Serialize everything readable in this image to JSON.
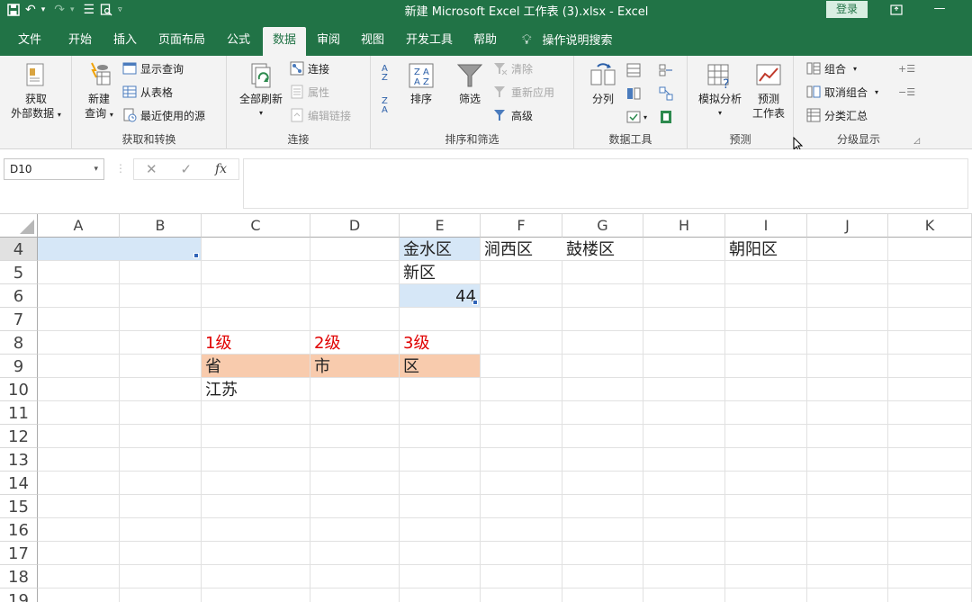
{
  "window": {
    "title": "新建 Microsoft Excel 工作表 (3).xlsx  -  Excel",
    "login": "登录"
  },
  "tabs": [
    {
      "label": "文件"
    },
    {
      "label": "开始"
    },
    {
      "label": "插入"
    },
    {
      "label": "页面布局"
    },
    {
      "label": "公式"
    },
    {
      "label": "数据",
      "active": true
    },
    {
      "label": "审阅"
    },
    {
      "label": "视图"
    },
    {
      "label": "开发工具"
    },
    {
      "label": "帮助"
    }
  ],
  "tell_me": "操作说明搜索",
  "ribbon": {
    "get_external": {
      "line1": "获取",
      "line2": "外部数据"
    },
    "get_transform": {
      "label": "获取和转换",
      "new_query_1": "新建",
      "new_query_2": "查询",
      "show_queries": "显示查询",
      "from_table": "从表格",
      "recent_sources": "最近使用的源"
    },
    "connections": {
      "label": "连接",
      "refresh_all": "全部刷新",
      "connections": "连接",
      "properties": "属性",
      "edit_links": "编辑链接"
    },
    "sort_filter": {
      "label": "排序和筛选",
      "sort": "排序",
      "filter": "筛选",
      "clear": "清除",
      "reapply": "重新应用",
      "advanced": "高级",
      "sort_az_top": "A",
      "sort_az_bottom": "Z",
      "sort_az_top2": "Z",
      "sort_az_bottom2": "A"
    },
    "data_tools": {
      "label": "数据工具",
      "text_to_columns": "分列"
    },
    "forecast": {
      "label": "预测",
      "what_if": "模拟分析",
      "forecast_sheet_1": "预测",
      "forecast_sheet_2": "工作表"
    },
    "outline": {
      "label": "分级显示",
      "group": "组合",
      "ungroup": "取消组合",
      "subtotal": "分类汇总"
    }
  },
  "formula_bar": {
    "name_box": "D10",
    "cancel": "✕",
    "enter": "✓",
    "fx": "fx",
    "content": ""
  },
  "columns": [
    "A",
    "B",
    "C",
    "D",
    "E",
    "F",
    "G",
    "H",
    "I",
    "J",
    "K"
  ],
  "rows": [
    "4",
    "5",
    "6",
    "7",
    "8",
    "9",
    "10",
    "11",
    "12",
    "13",
    "14",
    "15",
    "16",
    "17",
    "18",
    "19"
  ],
  "cells": {
    "E4": "金水区",
    "F4": "涧西区",
    "G4": "鼓楼区",
    "I4": "朝阳区",
    "E5": "新区",
    "E6": "44",
    "C8": "1级",
    "D8": "2级",
    "E8": "3级",
    "C9": "省",
    "D9": "市",
    "E9": "区",
    "C10": "江苏"
  },
  "colors": {
    "excel_green": "#217346",
    "level_red": "#e00000",
    "header_fill": "#f8cbad",
    "selection_blue": "#d6e7f7"
  }
}
